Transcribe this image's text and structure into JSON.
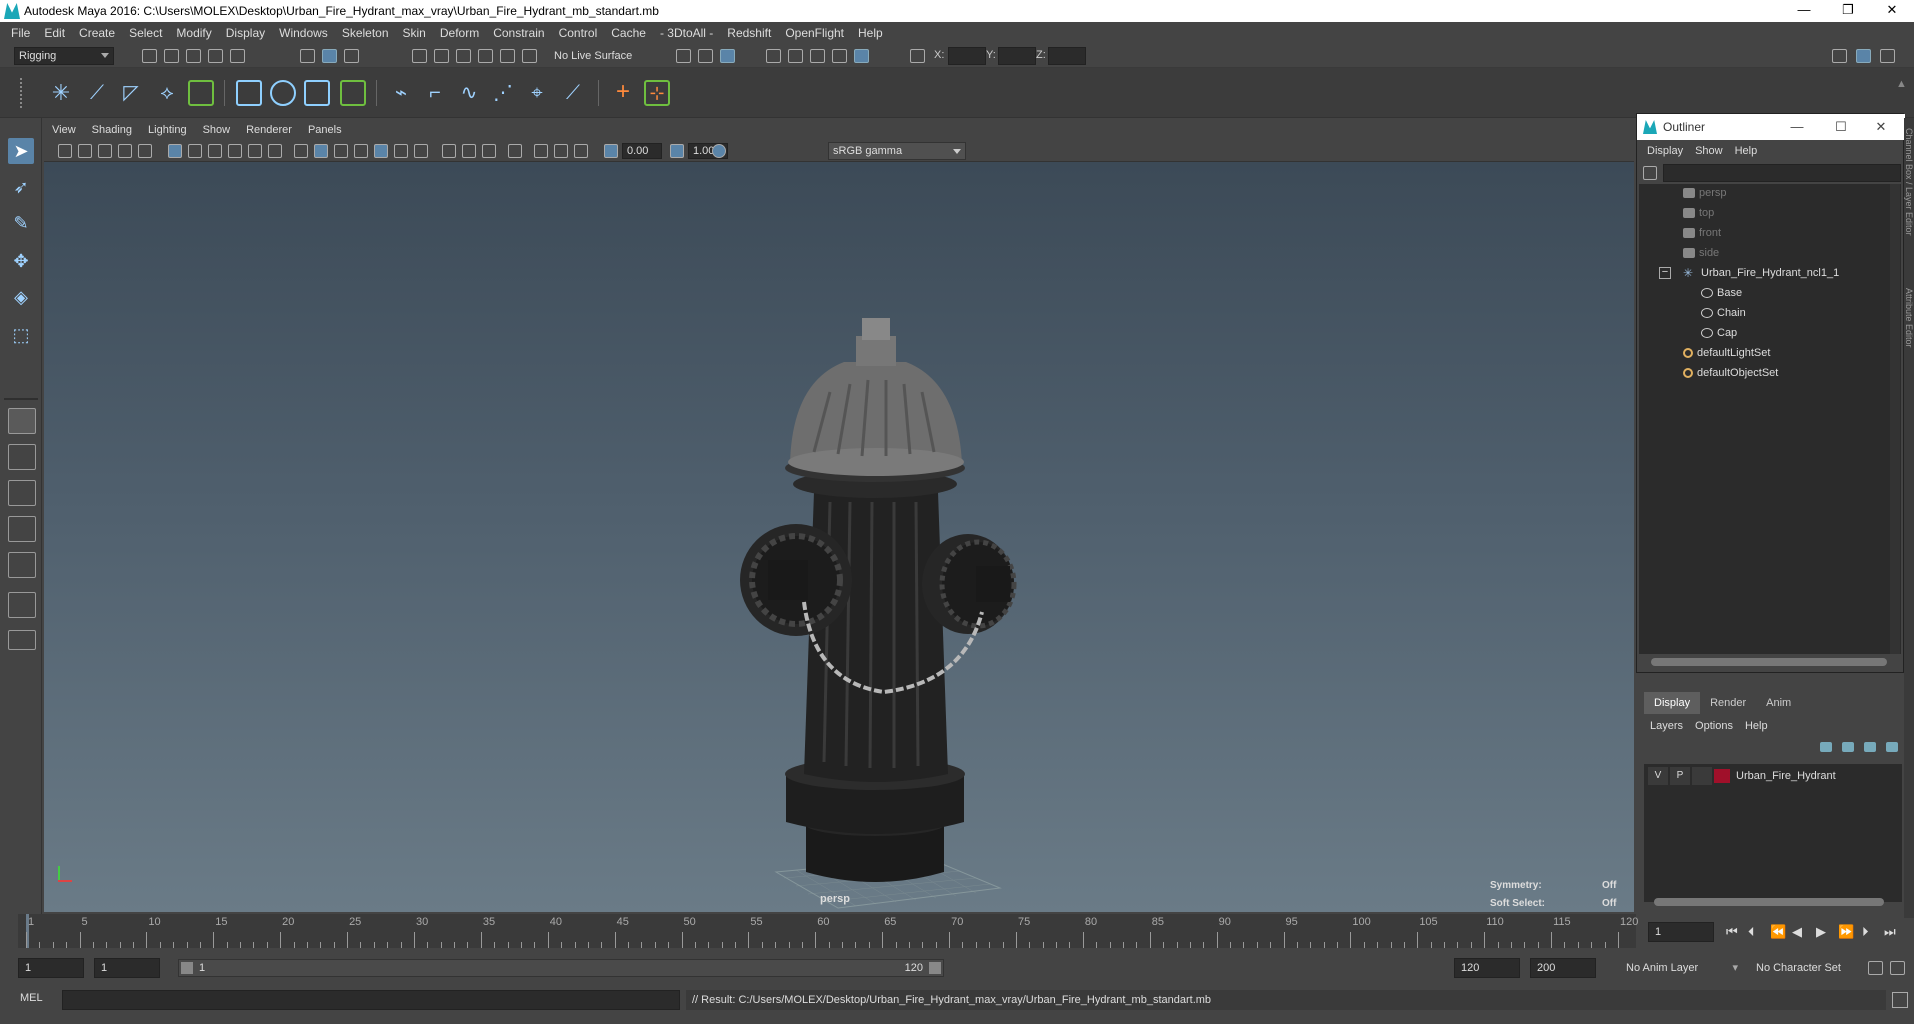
{
  "window": {
    "title": "Autodesk Maya 2016: C:\\Users\\MOLEX\\Desktop\\Urban_Fire_Hydrant_max_vray\\Urban_Fire_Hydrant_mb_standart.mb",
    "minimize": "—",
    "restore": "❐",
    "close": "✕"
  },
  "menubar": [
    "File",
    "Edit",
    "Create",
    "Select",
    "Modify",
    "Display",
    "Windows",
    "Skeleton",
    "Skin",
    "Deform",
    "Constrain",
    "Control",
    "Cache",
    "- 3DtoAll -",
    "Redshift",
    "OpenFlight",
    "Help"
  ],
  "statusline": {
    "mode": "Rigging",
    "live_surface": "No Live Surface",
    "x_label": "X:",
    "y_label": "Y:",
    "z_label": "Z:"
  },
  "panel_menu": [
    "View",
    "Shading",
    "Lighting",
    "Show",
    "Renderer",
    "Panels"
  ],
  "panel_toolbar": {
    "exposure": "0.00",
    "gamma": "1.00",
    "color_space": "sRGB gamma"
  },
  "viewport": {
    "camera": "persp",
    "symmetry_label": "Symmetry:",
    "symmetry_value": "Off",
    "soft_select_label": "Soft Select:",
    "soft_select_value": "Off"
  },
  "outliner": {
    "title": "Outliner",
    "menu": [
      "Display",
      "Show",
      "Help"
    ],
    "items": [
      {
        "label": "persp",
        "icon": "camera-icon"
      },
      {
        "label": "top",
        "icon": "camera-icon"
      },
      {
        "label": "front",
        "icon": "camera-icon"
      },
      {
        "label": "side",
        "icon": "camera-icon"
      },
      {
        "label": "Urban_Fire_Hydrant_ncl1_1",
        "icon": "group-icon"
      },
      {
        "label": "Base",
        "icon": "mesh-icon"
      },
      {
        "label": "Chain",
        "icon": "mesh-icon"
      },
      {
        "label": "Cap",
        "icon": "mesh-icon"
      },
      {
        "label": "defaultLightSet",
        "icon": "set-icon"
      },
      {
        "label": "defaultObjectSet",
        "icon": "set-icon"
      }
    ],
    "expand_toggle": "−"
  },
  "side_tabs": [
    "Channel Box / Layer Editor",
    "Attribute Editor"
  ],
  "layer_editor": {
    "tabs": [
      "Display",
      "Render",
      "Anim"
    ],
    "active_tab": "Display",
    "menu": [
      "Layers",
      "Options",
      "Help"
    ],
    "layer": {
      "v": "V",
      "p": "P",
      "name": "Urban_Fire_Hydrant",
      "color": "#a0102a"
    }
  },
  "timeline": {
    "ticks": [
      "1",
      "5",
      "10",
      "15",
      "20",
      "25",
      "30",
      "35",
      "40",
      "45",
      "50",
      "55",
      "60",
      "65",
      "70",
      "75",
      "80",
      "85",
      "90",
      "95",
      "100",
      "105",
      "110",
      "115",
      "120"
    ],
    "current_frame": "1"
  },
  "range": {
    "start": "1",
    "playback_start": "1",
    "bar_start": "1",
    "bar_end": "120",
    "playback_end": "120",
    "end": "200",
    "anim_layer": "No Anim Layer",
    "character_set": "No Character Set"
  },
  "command_line": {
    "language": "MEL",
    "result": "// Result: C:/Users/MOLEX/Desktop/Urban_Fire_Hydrant_max_vray/Urban_Fire_Hydrant_mb_standart.mb"
  },
  "colors": {
    "accent": "#5a84a8",
    "maya_teal": "#1aa7b7",
    "layer_red": "#a0102a",
    "shelf_green": "#6fbf3f",
    "shelf_orange": "#ff8a3c"
  }
}
